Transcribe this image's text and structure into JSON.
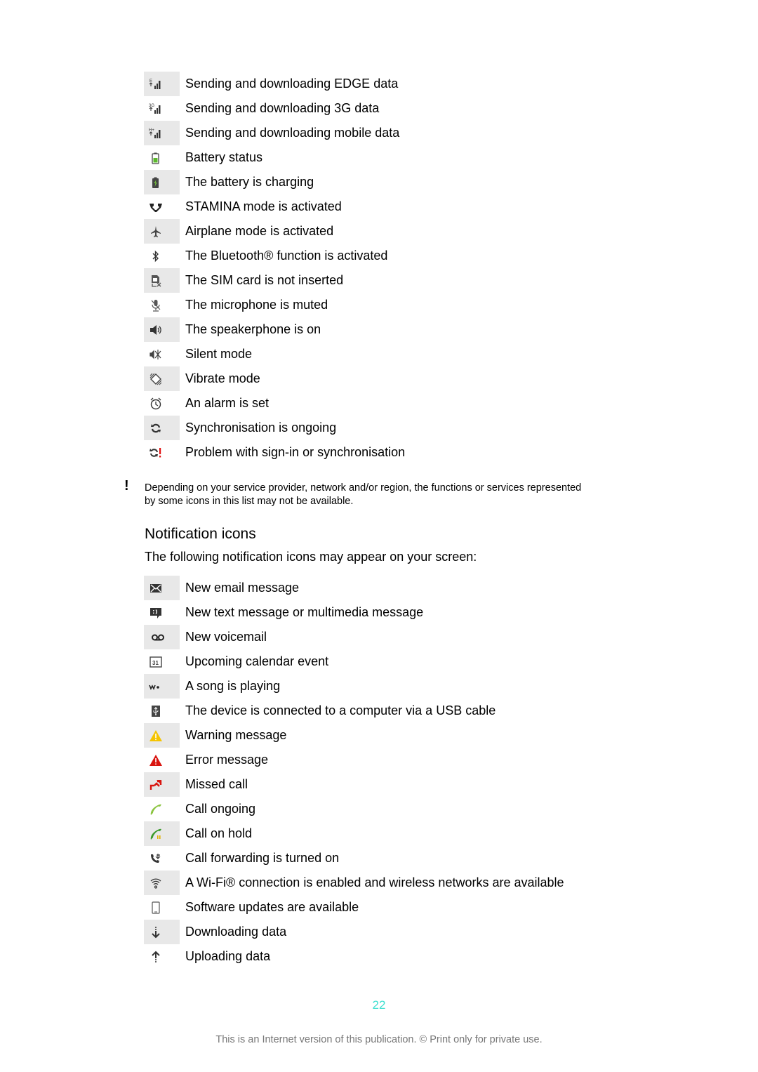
{
  "status_icons": [
    {
      "icon": "edge-data-icon",
      "label": "Sending and downloading EDGE data"
    },
    {
      "icon": "3g-data-icon",
      "label": "Sending and downloading 3G data"
    },
    {
      "icon": "mobile-data-icon",
      "label": "Sending and downloading mobile data"
    },
    {
      "icon": "battery-icon",
      "label": "Battery status"
    },
    {
      "icon": "battery-charging-icon",
      "label": "The battery is charging"
    },
    {
      "icon": "stamina-icon",
      "label": "STAMINA mode is activated"
    },
    {
      "icon": "airplane-icon",
      "label": "Airplane mode is activated"
    },
    {
      "icon": "bluetooth-icon",
      "label": "The Bluetooth® function is activated"
    },
    {
      "icon": "no-sim-icon",
      "label": "The SIM card is not inserted"
    },
    {
      "icon": "mic-muted-icon",
      "label": "The microphone is muted"
    },
    {
      "icon": "speakerphone-icon",
      "label": "The speakerphone is on"
    },
    {
      "icon": "silent-mode-icon",
      "label": "Silent mode"
    },
    {
      "icon": "vibrate-icon",
      "label": "Vibrate mode"
    },
    {
      "icon": "alarm-icon",
      "label": "An alarm is set"
    },
    {
      "icon": "sync-icon",
      "label": "Synchronisation is ongoing"
    },
    {
      "icon": "sync-problem-icon",
      "label": "Problem with sign-in or synchronisation"
    }
  ],
  "note": {
    "mark": "!",
    "text": "Depending on your service provider, network and/or region, the functions or services represented by some icons in this list may not be available."
  },
  "notification_section": {
    "heading": "Notification icons",
    "intro": "The following notification icons may appear on your screen:"
  },
  "notification_icons": [
    {
      "icon": "email-icon",
      "label": "New email message"
    },
    {
      "icon": "text-message-icon",
      "label": "New text message or multimedia message"
    },
    {
      "icon": "voicemail-icon",
      "label": "New voicemail"
    },
    {
      "icon": "calendar-icon",
      "label": "Upcoming calendar event",
      "glyph_text": "31"
    },
    {
      "icon": "walkman-icon",
      "label": "A song is playing"
    },
    {
      "icon": "usb-icon",
      "label": "The device is connected to a computer via a USB cable"
    },
    {
      "icon": "warning-icon",
      "label": "Warning message"
    },
    {
      "icon": "error-icon",
      "label": "Error message"
    },
    {
      "icon": "missed-call-icon",
      "label": "Missed call"
    },
    {
      "icon": "call-ongoing-icon",
      "label": "Call ongoing"
    },
    {
      "icon": "call-hold-icon",
      "label": "Call on hold"
    },
    {
      "icon": "call-forward-icon",
      "label": "Call forwarding is turned on"
    },
    {
      "icon": "wifi-icon",
      "label": "A Wi-Fi® connection is enabled and wireless networks are available"
    },
    {
      "icon": "software-update-icon",
      "label": "Software updates are available"
    },
    {
      "icon": "download-icon",
      "label": "Downloading data"
    },
    {
      "icon": "upload-icon",
      "label": "Uploading data"
    }
  ],
  "colors": {
    "page_number": "#40e0d0",
    "warning": "#f5c400",
    "error": "#d9140f",
    "call_green": "#8bc43f",
    "hold_green": "#3a9a2a"
  },
  "page_number": "22",
  "footer": "This is an Internet version of this publication. © Print only for private use."
}
